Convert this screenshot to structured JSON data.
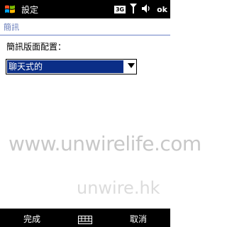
{
  "title_bar": {
    "title": "設定",
    "status_3g": "3G",
    "ok_label": "ok",
    "icons": [
      "windows-start-icon",
      "signal-icon",
      "volume-icon"
    ]
  },
  "page": {
    "section_title": "簡訊"
  },
  "form": {
    "label": "簡訊版面配置：",
    "selected_value": "聊天式的"
  },
  "watermarks": [
    "www.unwirelife.com",
    "unwire.hk"
  ],
  "soft_keys": {
    "left": "完成",
    "right": "取消",
    "center_icon": "keyboard-icon"
  },
  "colors": {
    "bars": "#000000",
    "accent": "#0b2e87",
    "header_text": "#6479b8"
  }
}
